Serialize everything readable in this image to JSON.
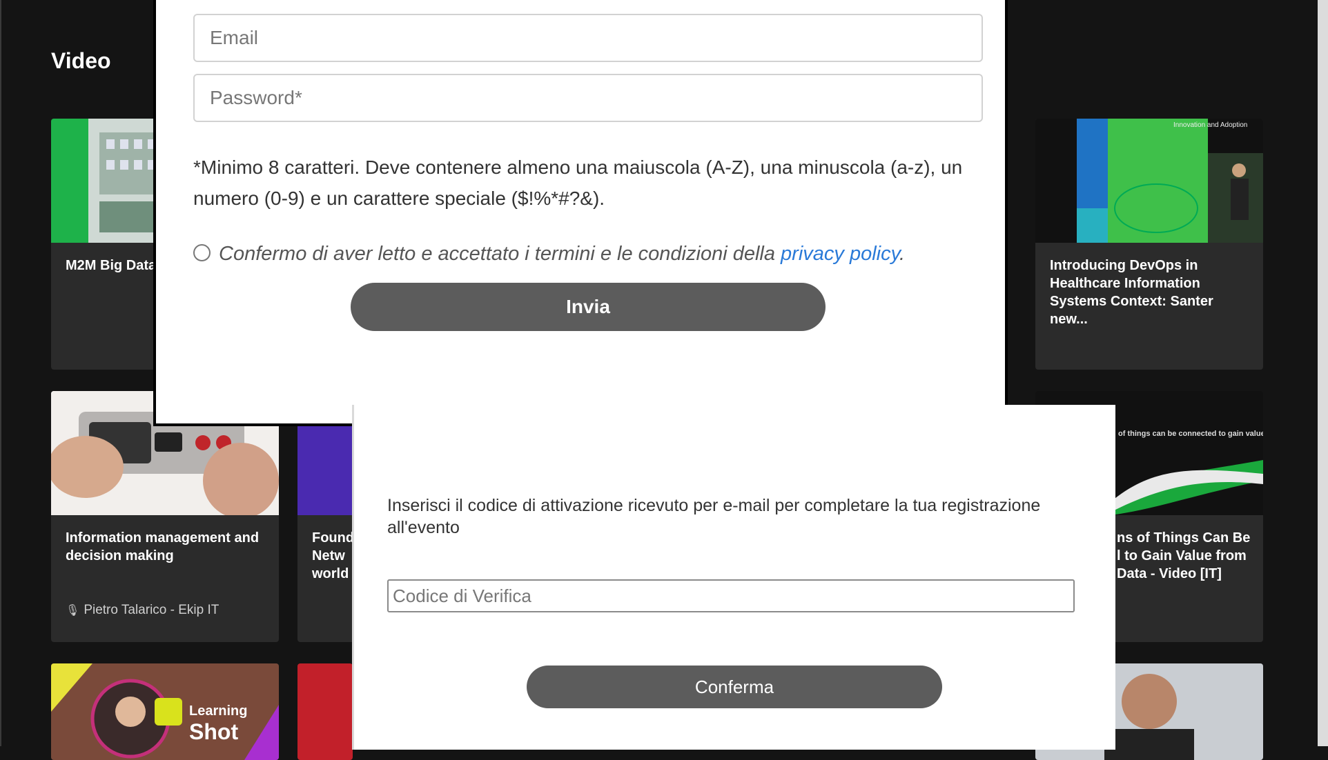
{
  "section": {
    "title": "Video"
  },
  "cards": [
    {
      "title": "M2M Big Data",
      "author": ""
    },
    {
      "title": "Introducing DevOps in Healthcare Information Systems Context: Santer new...",
      "thumb_heading": "Innovation and Adoption"
    },
    {
      "title": "Information management and decision making",
      "author": "Pietro Talarico - Ekip IT"
    },
    {
      "title": "Found\nNetw\nworld"
    },
    {
      "title": "ns of Things Can Be\nl to Gain Value from\nData - Video [IT]",
      "thumb_caption": "of things can be connected to gain value from real-time data"
    },
    {
      "thumb_badge_top": "Learning",
      "thumb_badge_bottom": "Shot"
    }
  ],
  "signup_modal": {
    "email_placeholder": "Email",
    "password_placeholder": "Password*",
    "password_hint": "*Minimo 8 caratteri. Deve contenere almeno una maiuscola (A-Z), una minuscola (a-z), un numero (0-9) e un carattere speciale ($!%*#?&).",
    "consent_text": "Confermo di aver letto e accettato i termini e le condizioni della ",
    "consent_link": "privacy policy",
    "consent_end": ".",
    "submit_label": "Invia"
  },
  "verify_modal": {
    "instructions": "Inserisci il codice di attivazione ricevuto per e-mail per completare la tua registrazione all'evento",
    "code_placeholder": "Codice di Verifica",
    "confirm_label": "Conferma"
  },
  "colors": {
    "page_bg": "#141414",
    "card_bg": "#2b2b2b",
    "button_bg": "#5c5c5c",
    "link": "#2a7ad8"
  }
}
